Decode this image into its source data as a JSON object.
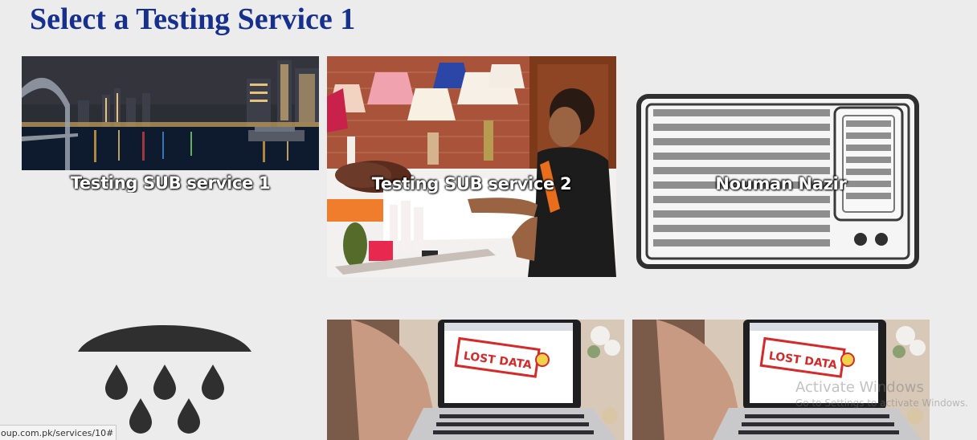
{
  "page": {
    "title": "Select a Testing Service 1"
  },
  "services": [
    {
      "label": "Testing SUB service 1",
      "image": "night-city-river-photo"
    },
    {
      "label": "Testing SUB service 2",
      "image": "spa-massage-photo"
    },
    {
      "label": "Nouman Nazir",
      "image": "air-conditioner-icon"
    },
    {
      "label": "",
      "image": "rain-cloud-icon"
    },
    {
      "label": "",
      "image": "lost-data-laptop-photo",
      "screen_text": "LOST DATA"
    },
    {
      "label": "",
      "image": "lost-data-laptop-photo",
      "screen_text": "LOST DATA"
    }
  ],
  "status_bar": {
    "url": "oup.com.pk/services/10#"
  },
  "watermark": {
    "title": "Activate Windows",
    "subtitle": "Go to Settings to activate Windows."
  }
}
